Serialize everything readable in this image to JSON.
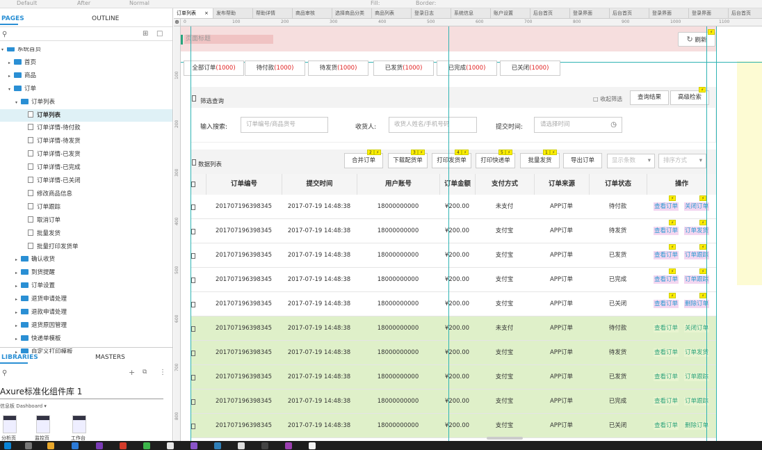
{
  "topbar": {
    "items": [
      "Default",
      "After",
      "Normal",
      "Fill:",
      "Border:"
    ]
  },
  "left_panel": {
    "pages_tab": "PAGES",
    "outline_tab": "OUTLINE",
    "libraries_tab": "LIBRARIES",
    "masters_tab": "MASTERS",
    "library_name": "Axure标准化组件库 1",
    "library_sub": "信息板 Dashboard ▾",
    "library_items": [
      "分析页",
      "监控页",
      "工作台"
    ],
    "tree": [
      {
        "label": "系统首页",
        "level": 0,
        "type": "folder"
      },
      {
        "label": "首页",
        "level": 1,
        "type": "folder"
      },
      {
        "label": "商品",
        "level": 1,
        "type": "folder"
      },
      {
        "label": "订单",
        "level": 1,
        "type": "folder"
      },
      {
        "label": "订单列表",
        "level": 2,
        "type": "folder"
      },
      {
        "label": "订单列表",
        "level": 3,
        "type": "page",
        "selected": true
      },
      {
        "label": "订单详情-待付款",
        "level": 3,
        "type": "page"
      },
      {
        "label": "订单详情-待发货",
        "level": 3,
        "type": "page"
      },
      {
        "label": "订单详情-已发货",
        "level": 3,
        "type": "page"
      },
      {
        "label": "订单详情-已完成",
        "level": 3,
        "type": "page"
      },
      {
        "label": "订单详情-已关闭",
        "level": 3,
        "type": "page"
      },
      {
        "label": "修改商品信息",
        "level": 3,
        "type": "page"
      },
      {
        "label": "订单跟踪",
        "level": 3,
        "type": "page"
      },
      {
        "label": "取消订单",
        "level": 3,
        "type": "page"
      },
      {
        "label": "批量发货",
        "level": 3,
        "type": "page"
      },
      {
        "label": "批量打印发货单",
        "level": 3,
        "type": "page"
      },
      {
        "label": "确认收货",
        "level": 2,
        "type": "folder"
      },
      {
        "label": "到货提醒",
        "level": 2,
        "type": "folder"
      },
      {
        "label": "订单设置",
        "level": 2,
        "type": "folder"
      },
      {
        "label": "退货申请处理",
        "level": 2,
        "type": "folder"
      },
      {
        "label": "退款申请处理",
        "level": 2,
        "type": "folder"
      },
      {
        "label": "退货原因管理",
        "level": 2,
        "type": "folder"
      },
      {
        "label": "快递单模板",
        "level": 2,
        "type": "folder"
      },
      {
        "label": "自定义打印模板",
        "level": 2,
        "type": "folder"
      }
    ]
  },
  "doc_tabs": [
    "订单列表",
    "发布帮助",
    "帮助详情",
    "商品审核",
    "选择商品分类",
    "商品列表",
    "登录日志",
    "系统信息",
    "账户设置",
    "后台首页",
    "登录界面",
    "后台首页",
    "登录界面",
    "登录界面",
    "后台首页"
  ],
  "ruler_marks": [
    "0",
    "100",
    "200",
    "300",
    "400",
    "500",
    "600",
    "700",
    "800",
    "900",
    "1000",
    "1100"
  ],
  "vruler_marks": [
    "100",
    "200",
    "300",
    "400",
    "500",
    "600",
    "700",
    "800"
  ],
  "page": {
    "title": "页面标题",
    "refresh": "刷新",
    "status_tabs": [
      {
        "label": "全部订单",
        "count": "(1000)"
      },
      {
        "label": "待付款",
        "count": "(1000)"
      },
      {
        "label": "待发货",
        "count": "(1000)"
      },
      {
        "label": "已发货",
        "count": "(1000)"
      },
      {
        "label": "已完成",
        "count": "(1000)"
      },
      {
        "label": "已关闭",
        "count": "(1000)"
      }
    ],
    "filter": {
      "title": "筛选查询",
      "collapse": "收起筛选",
      "query_btn": "查询结果",
      "advanced_btn": "高级检索",
      "search_label": "输入搜索:",
      "search_placeholder": "订单编号/商品货号",
      "consignee_label": "收货人:",
      "consignee_placeholder": "收货人姓名/手机号码",
      "time_label": "提交时间:",
      "time_placeholder": "请选择时间"
    },
    "list": {
      "title": "数据列表",
      "buttons": [
        {
          "label": "合并订单",
          "badge": "2"
        },
        {
          "label": "下载配货单",
          "badge": "3"
        },
        {
          "label": "打印发货单",
          "badge": "4"
        },
        {
          "label": "打印快递单",
          "badge": "5"
        },
        {
          "label": "批量发货",
          "badge": "1"
        },
        {
          "label": "导出订单",
          "badge": ""
        }
      ],
      "select_count": "显示条数",
      "select_sort": "排序方式"
    },
    "table": {
      "headers": [
        "订单编号",
        "提交时间",
        "用户账号",
        "订单金额",
        "支付方式",
        "订单来源",
        "订单状态",
        "操作"
      ],
      "rows": [
        [
          "201707196398345",
          "2017-07-19 14:48:38",
          "18000000000",
          "¥200.00",
          "未支付",
          "APP订单",
          "待付款",
          "查看订单",
          "关闭订单"
        ],
        [
          "201707196398345",
          "2017-07-19 14:48:38",
          "18000000000",
          "¥200.00",
          "支付宝",
          "APP订单",
          "待发货",
          "查看订单",
          "订单发货"
        ],
        [
          "201707196398345",
          "2017-07-19 14:48:38",
          "18000000000",
          "¥200.00",
          "支付宝",
          "APP订单",
          "已发货",
          "查看订单",
          "订单跟踪"
        ],
        [
          "201707196398345",
          "2017-07-19 14:48:38",
          "18000000000",
          "¥200.00",
          "支付宝",
          "APP订单",
          "已完成",
          "查看订单",
          "订单跟踪"
        ],
        [
          "201707196398345",
          "2017-07-19 14:48:38",
          "18000000000",
          "¥200.00",
          "支付宝",
          "APP订单",
          "已关闭",
          "查看订单",
          "删除订单"
        ],
        [
          "201707196398345",
          "2017-07-19 14:48:38",
          "18000000000",
          "¥200.00",
          "未支付",
          "APP订单",
          "待付款",
          "查看订单",
          "关闭订单"
        ],
        [
          "201707196398345",
          "2017-07-19 14:48:38",
          "18000000000",
          "¥200.00",
          "支付宝",
          "APP订单",
          "待发货",
          "查看订单",
          "订单发货"
        ],
        [
          "201707196398345",
          "2017-07-19 14:48:38",
          "18000000000",
          "¥200.00",
          "支付宝",
          "APP订单",
          "已发货",
          "查看订单",
          "订单跟踪"
        ],
        [
          "201707196398345",
          "2017-07-19 14:48:38",
          "18000000000",
          "¥200.00",
          "支付宝",
          "APP订单",
          "已完成",
          "查看订单",
          "订单跟踪"
        ],
        [
          "201707196398345",
          "2017-07-19 14:48:38",
          "18000000000",
          "¥200.00",
          "支付宝",
          "APP订单",
          "已关闭",
          "查看订单",
          "删除订单"
        ]
      ]
    }
  },
  "colors": {
    "accent": "#2a8fd4",
    "count_red": "#e02020",
    "link_blue": "#2d9bd2",
    "row_green": "#dff0c9",
    "title_bar": "#f6dede",
    "guide": "#2fb3b3"
  }
}
